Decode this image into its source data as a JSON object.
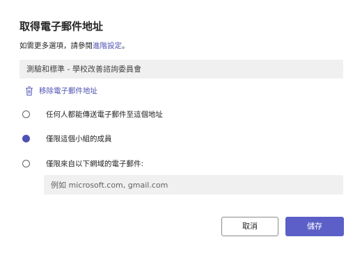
{
  "dialog": {
    "title": "取得電子郵件地址",
    "subtitle_prefix": "如需更多選項，請參閱",
    "subtitle_link": "進階設定",
    "subtitle_suffix": "。",
    "team_name": "測驗和標準 - 學校改善諮詢委員會",
    "remove_label": "移除電子郵件地址",
    "options": [
      {
        "label": "任何人都能傳送電子郵件至這個地址",
        "checked": false
      },
      {
        "label": "僅限這個小組的成員",
        "checked": true
      },
      {
        "label": "僅限來自以下網域的電子郵件:",
        "checked": false
      }
    ],
    "domain_placeholder": "例如 microsoft.com, gmail.com",
    "domain_value": "",
    "cancel_label": "取消",
    "save_label": "儲存"
  },
  "colors": {
    "accent": "#5b5fc7",
    "link": "#4f52b2",
    "field_bg": "#f0f0f0"
  },
  "icons": {
    "remove": "trash-icon"
  }
}
